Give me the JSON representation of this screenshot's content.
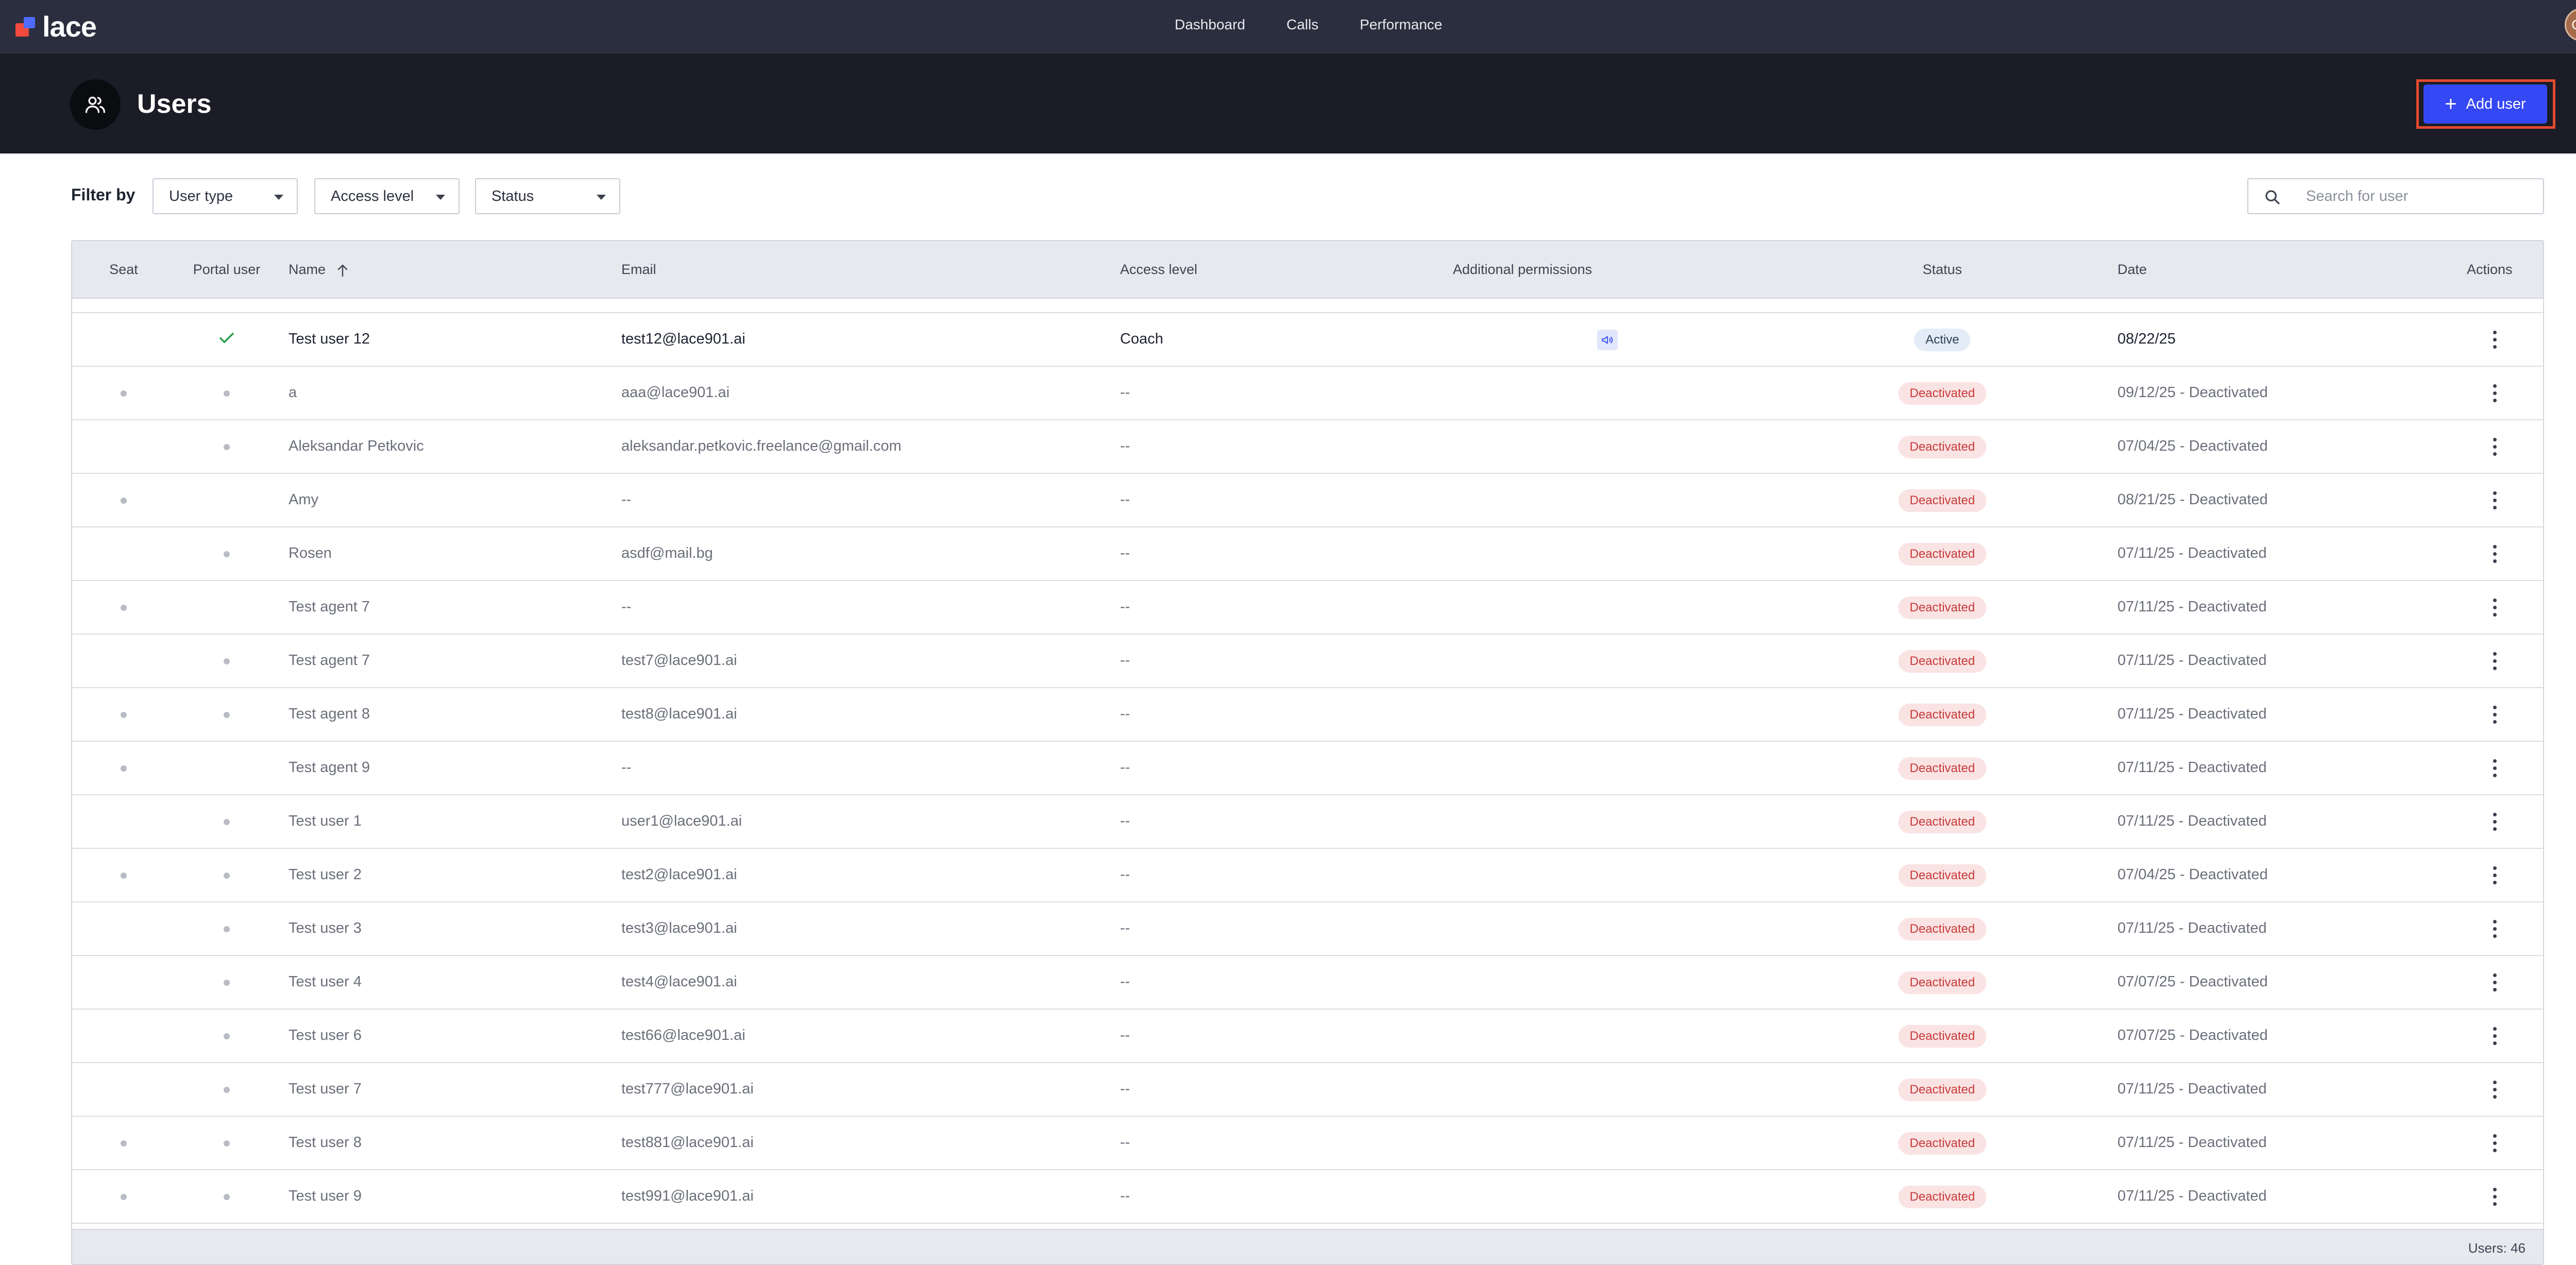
{
  "app": {
    "logo_text": "lace"
  },
  "nav": {
    "links": [
      "Dashboard",
      "Calls",
      "Performance"
    ],
    "avatar_initials": "GK"
  },
  "header": {
    "title": "Users",
    "add_button_label": "Add user"
  },
  "filters": {
    "label": "Filter by",
    "dropdowns": [
      "User type",
      "Access level",
      "Status"
    ],
    "search_placeholder": "Search for user"
  },
  "table": {
    "columns": {
      "seat": "Seat",
      "portal_user": "Portal user",
      "name": "Name",
      "email": "Email",
      "access_level": "Access level",
      "additional_permissions": "Additional permissions",
      "status": "Status",
      "date": "Date",
      "actions": "Actions"
    },
    "sort": {
      "column": "name",
      "direction": "ascending"
    },
    "rows": [
      {
        "seat": false,
        "portal": "check",
        "name": "Test user 12",
        "email": "test12@lace901.ai",
        "access": "Coach",
        "permission_icon": "megaphone-icon",
        "status": "Active",
        "date": "08/22/25"
      },
      {
        "seat": true,
        "portal": "dot",
        "name": "a",
        "email": "aaa@lace901.ai",
        "access": "--",
        "status": "Deactivated",
        "date": "09/12/25 - Deactivated"
      },
      {
        "seat": false,
        "portal": "dot",
        "name": "Aleksandar Petkovic",
        "email": "aleksandar.petkovic.freelance@gmail.com",
        "access": "--",
        "status": "Deactivated",
        "date": "07/04/25 - Deactivated"
      },
      {
        "seat": true,
        "portal": "none",
        "name": "Amy",
        "email": "--",
        "access": "--",
        "status": "Deactivated",
        "date": "08/21/25 - Deactivated"
      },
      {
        "seat": false,
        "portal": "dot",
        "name": "Rosen",
        "email": "asdf@mail.bg",
        "access": "--",
        "status": "Deactivated",
        "date": "07/11/25 - Deactivated"
      },
      {
        "seat": true,
        "portal": "none",
        "name": "Test agent 7",
        "email": "--",
        "access": "--",
        "status": "Deactivated",
        "date": "07/11/25 - Deactivated"
      },
      {
        "seat": false,
        "portal": "dot",
        "name": "Test agent 7",
        "email": "test7@lace901.ai",
        "access": "--",
        "status": "Deactivated",
        "date": "07/11/25 - Deactivated"
      },
      {
        "seat": true,
        "portal": "dot",
        "name": "Test agent 8",
        "email": "test8@lace901.ai",
        "access": "--",
        "status": "Deactivated",
        "date": "07/11/25 - Deactivated"
      },
      {
        "seat": true,
        "portal": "none",
        "name": "Test agent 9",
        "email": "--",
        "access": "--",
        "status": "Deactivated",
        "date": "07/11/25 - Deactivated"
      },
      {
        "seat": false,
        "portal": "dot",
        "name": "Test user 1",
        "email": "user1@lace901.ai",
        "access": "--",
        "status": "Deactivated",
        "date": "07/11/25 - Deactivated"
      },
      {
        "seat": true,
        "portal": "dot",
        "name": "Test user 2",
        "email": "test2@lace901.ai",
        "access": "--",
        "status": "Deactivated",
        "date": "07/04/25 - Deactivated"
      },
      {
        "seat": false,
        "portal": "dot",
        "name": "Test user 3",
        "email": "test3@lace901.ai",
        "access": "--",
        "status": "Deactivated",
        "date": "07/11/25 - Deactivated"
      },
      {
        "seat": false,
        "portal": "dot",
        "name": "Test user 4",
        "email": "test4@lace901.ai",
        "access": "--",
        "status": "Deactivated",
        "date": "07/07/25 - Deactivated"
      },
      {
        "seat": false,
        "portal": "dot",
        "name": "Test user 6",
        "email": "test66@lace901.ai",
        "access": "--",
        "status": "Deactivated",
        "date": "07/07/25 - Deactivated"
      },
      {
        "seat": false,
        "portal": "dot",
        "name": "Test user 7",
        "email": "test777@lace901.ai",
        "access": "--",
        "status": "Deactivated",
        "date": "07/11/25 - Deactivated"
      },
      {
        "seat": true,
        "portal": "dot",
        "name": "Test user 8",
        "email": "test881@lace901.ai",
        "access": "--",
        "status": "Deactivated",
        "date": "07/11/25 - Deactivated"
      },
      {
        "seat": true,
        "portal": "dot",
        "name": "Test user 9",
        "email": "test991@lace901.ai",
        "access": "--",
        "status": "Deactivated",
        "date": "07/11/25 - Deactivated"
      }
    ],
    "footer_count": "Users: 46"
  },
  "colors": {
    "nav_bg": "#2b2e3e",
    "header_bg": "#1b1c25",
    "accent": "#3548f5",
    "highlight": "#e34a2f",
    "active_check": "#2e9e4f",
    "deactivated_text": "#c83a3a"
  }
}
